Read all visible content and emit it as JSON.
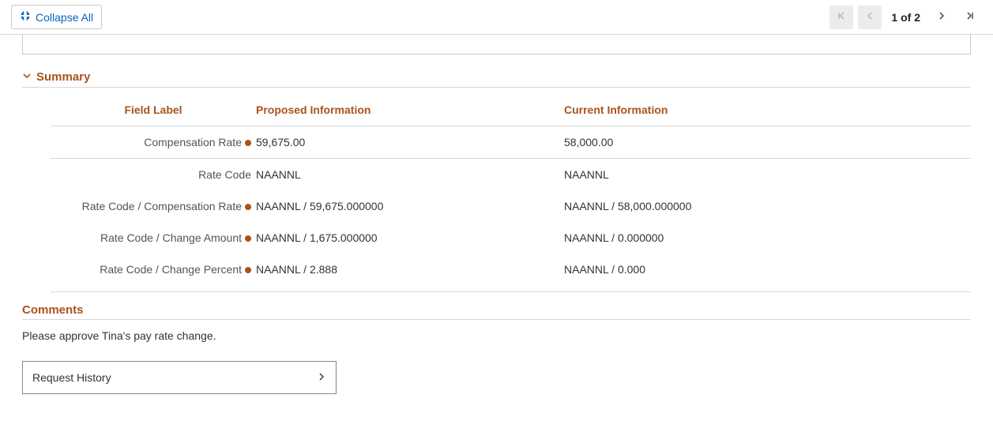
{
  "topbar": {
    "collapse_label": "Collapse All",
    "page_label": "1 of 2"
  },
  "summary": {
    "title": "Summary",
    "headers": {
      "field": "Field Label",
      "proposed": "Proposed Information",
      "current": "Current Information"
    },
    "rows": [
      {
        "label": "Compensation Rate",
        "dot": true,
        "proposed": "59,675.00",
        "current": "58,000.00"
      },
      {
        "label": "Rate Code",
        "dot": false,
        "proposed": "NAANNL",
        "current": "NAANNL"
      },
      {
        "label": "Rate Code / Compensation Rate",
        "dot": true,
        "proposed": "NAANNL / 59,675.000000",
        "current": "NAANNL / 58,000.000000"
      },
      {
        "label": "Rate Code / Change Amount",
        "dot": true,
        "proposed": "NAANNL / 1,675.000000",
        "current": "NAANNL / 0.000000"
      },
      {
        "label": "Rate Code / Change Percent",
        "dot": true,
        "proposed": "NAANNL / 2.888",
        "current": "NAANNL / 0.000"
      }
    ]
  },
  "comments": {
    "label": "Comments",
    "text": "Please approve Tina's pay rate change."
  },
  "request_history_label": "Request History"
}
